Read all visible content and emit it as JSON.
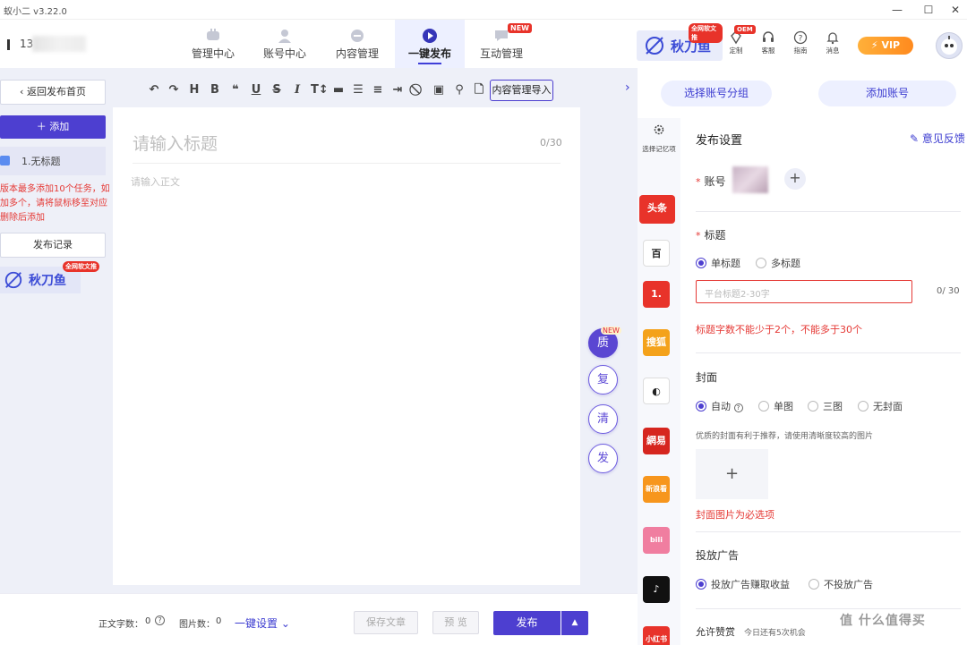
{
  "app": {
    "title": "蚁小二 v3.22.0"
  },
  "window": {
    "min": "—",
    "max": "☐",
    "close": "✕"
  },
  "user": {
    "name_partial": "13"
  },
  "nav": {
    "tabs": [
      {
        "label": "管理中心"
      },
      {
        "label": "账号中心"
      },
      {
        "label": "内容管理"
      },
      {
        "label": "一键发布"
      },
      {
        "label": "互动管理",
        "badge": "NEW"
      }
    ],
    "active": "一键发布"
  },
  "brand": {
    "name": "秋刀鱼",
    "badge": "全网软文推"
  },
  "header_icons": [
    {
      "label": "定制",
      "icon": "diamond-icon",
      "badge": "OEM"
    },
    {
      "label": "客服",
      "icon": "headset-icon"
    },
    {
      "label": "指南",
      "icon": "help-icon"
    },
    {
      "label": "消息",
      "icon": "bell-icon"
    }
  ],
  "vip": {
    "label": "VIP"
  },
  "left": {
    "back": "返回发布首页",
    "add": "添加",
    "task": "1.无标题",
    "notice": "版本最多添加10个任务，如\n加多个，请将鼠标移至对应\n删除后添加",
    "history": "发布记录",
    "brand": "秋刀鱼",
    "brand_badge": "全网软文推"
  },
  "toolbar": {
    "import_label": "内容管理导入",
    "tools": [
      "undo-icon",
      "redo-icon",
      "heading-icon",
      "bold-icon",
      "quote-icon",
      "underline-icon",
      "strike-icon",
      "italic-icon",
      "font-size-icon",
      "hr-icon",
      "list-icon",
      "align-icon",
      "indent-icon",
      "clear-icon",
      "image-icon",
      "search-icon",
      "file-icon"
    ]
  },
  "editor": {
    "title_placeholder": "请输入标题",
    "title_count": "0/30",
    "body_placeholder": "请输入正文"
  },
  "float_buttons": [
    {
      "label": "质",
      "badge": "NEW"
    },
    {
      "label": "复"
    },
    {
      "label": "清"
    },
    {
      "label": "发"
    }
  ],
  "bottom": {
    "word_count_label": "正文字数：",
    "word_count": "0",
    "image_count_label": "图片数：",
    "image_count": "0",
    "one_click_settings": "一键设置",
    "save": "保存文章",
    "preview": "预 览",
    "publish": "发布"
  },
  "right": {
    "select_group": "选择账号分组",
    "add_account": "添加账号",
    "memory_label": "选择记忆项",
    "header": "发布设置",
    "feedback": "意见反馈",
    "account_label": "账号",
    "title_label": "标题",
    "title_modes": [
      "单标题",
      "多标题"
    ],
    "title_mode_selected": "单标题",
    "title_placeholder": "平台标题2-30字",
    "title_count": "0/ 30",
    "title_error": "标题字数不能少于2个，不能多于30个",
    "cover_label": "封面",
    "cover_modes": [
      "自动",
      "单图",
      "三图",
      "无封面"
    ],
    "cover_mode_selected": "自动",
    "cover_tip": "优质的封面有利于推荐，请使用清晰度较高的图片",
    "cover_plus": "+",
    "cover_error": "封面图片为必选项",
    "ad_label": "投放广告",
    "ad_modes": [
      "投放广告赚取收益",
      "不投放广告"
    ],
    "ad_selected": "投放广告赚取收益",
    "reward_label": "允许赞赏",
    "reward_note": "今日还有5次机会"
  },
  "platforms": [
    {
      "name": "头条",
      "label": "头条",
      "color": "#e8332a"
    },
    {
      "name": "百家号",
      "label": "百",
      "color": "#ffffff"
    },
    {
      "name": "一点资讯",
      "label": "1.",
      "color": "#e8332a"
    },
    {
      "name": "搜狐",
      "label": "搜狐",
      "color": "#f4a21b"
    },
    {
      "name": "大鱼号",
      "label": "◐",
      "color": "#ffffff"
    },
    {
      "name": "网易",
      "label": "網易",
      "color": "#d6261f"
    },
    {
      "name": "新浪看点",
      "label": "新浪看",
      "color": "#f7961d"
    },
    {
      "name": "bilibili",
      "label": "bili",
      "color": "#f07ea0"
    },
    {
      "name": "抖音",
      "label": "♪",
      "color": "#111111"
    },
    {
      "name": "小红书",
      "label": "小红书",
      "color": "#e8332a"
    }
  ],
  "watermark": "值 什么值得买",
  "colors": {
    "primary": "#4d3fd0",
    "error": "#e53935",
    "nav_active_bg": "#edf0ff"
  }
}
